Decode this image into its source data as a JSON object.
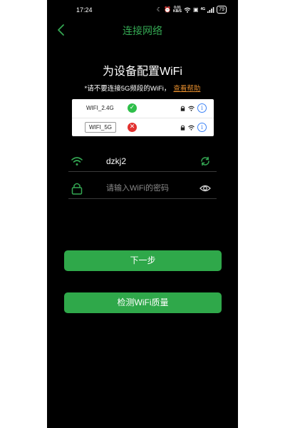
{
  "status_bar": {
    "time": "17:24",
    "speed_top": "0.01",
    "speed_bottom": "KB/S",
    "network_small": "4G",
    "battery": "79"
  },
  "nav": {
    "title": "连接网络"
  },
  "heading": {
    "title": "为设备配置WiFi",
    "hint": "*请不要连接5G频段的WiFi，",
    "help_link": "查看帮助"
  },
  "example": {
    "rows": [
      {
        "ssid": "WIFI_2.4G",
        "status": "ok"
      },
      {
        "ssid": "WIFI_5G",
        "status": "bad"
      }
    ],
    "info_glyph": "i"
  },
  "form": {
    "ssid_value": "dzkj2",
    "password_placeholder": "请输入WiFi的密码",
    "password_value": ""
  },
  "buttons": {
    "next_label": "下一步",
    "check_label": "检测WiFi质量"
  },
  "colors": {
    "accent": "#34a853",
    "button": "#2fa84a",
    "link": "#e08a2c",
    "ok": "#2fbf4a",
    "bad": "#e2312f",
    "info": "#3b82f6"
  },
  "icons": {
    "back": "chevron-left-icon",
    "ssid_field": "wifi-icon",
    "refresh": "refresh-icon",
    "password_field": "lock-icon",
    "visibility": "eye-icon"
  }
}
